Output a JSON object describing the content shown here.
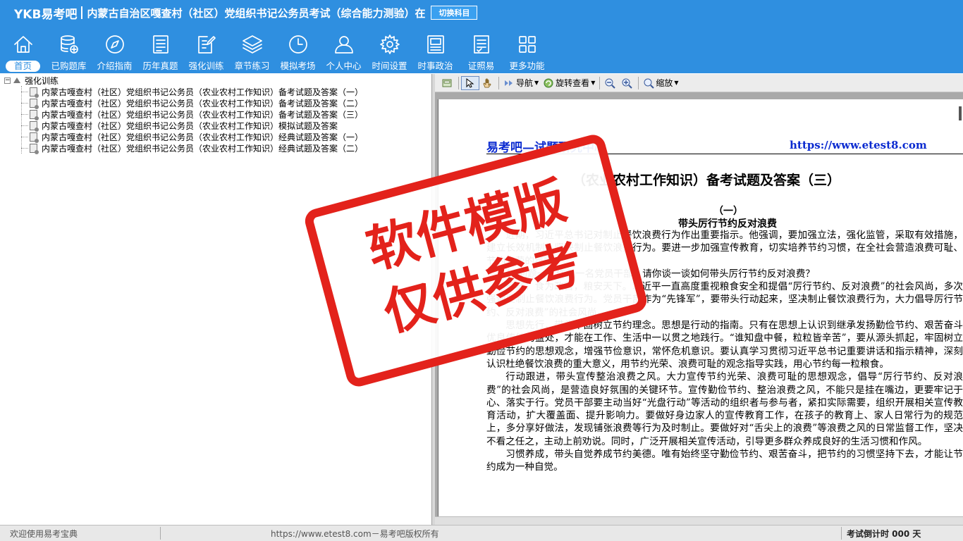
{
  "header": {
    "logo": "YKB易考吧",
    "title": "内蒙古自治区嘎查村（社区）党组织书记公务员考试（综合能力测验）在",
    "switch_label": "切换科目"
  },
  "nav": [
    {
      "label": "首页",
      "icon": "home-icon"
    },
    {
      "label": "已购题库",
      "icon": "database-icon"
    },
    {
      "label": "介绍指南",
      "icon": "compass-icon"
    },
    {
      "label": "历年真题",
      "icon": "list-icon"
    },
    {
      "label": "强化训练",
      "icon": "edit-icon"
    },
    {
      "label": "章节练习",
      "icon": "layers-icon"
    },
    {
      "label": "模拟考场",
      "icon": "clock-icon"
    },
    {
      "label": "个人中心",
      "icon": "user-icon"
    },
    {
      "label": "时间设置",
      "icon": "gear-icon"
    },
    {
      "label": "时事政治",
      "icon": "news-icon"
    },
    {
      "label": "证照易",
      "icon": "certificate-icon"
    },
    {
      "label": "更多功能",
      "icon": "grid-icon"
    }
  ],
  "tree": {
    "root_expander": "−",
    "root": "强化训练",
    "items": [
      "内蒙古嘎查村（社区）党组织书记公务员（农业农村工作知识）备考试题及答案（一）",
      "内蒙古嘎查村（社区）党组织书记公务员（农业农村工作知识）备考试题及答案（二）",
      "内蒙古嘎查村（社区）党组织书记公务员（农业农村工作知识）备考试题及答案（三）",
      "内蒙古嘎查村（社区）党组织书记公务员（农业农村工作知识）模拟试题及答案",
      "内蒙古嘎查村（社区）党组织书记公务员（农业农村工作知识）经典试题及答案（一）",
      "内蒙古嘎查村（社区）党组织书记公务员（农业农村工作知识）经典试题及答案（二）"
    ]
  },
  "toolbar": {
    "nav_label": "导航",
    "rotate_label": "旋转查看",
    "zoom_label": "缩放"
  },
  "document": {
    "brand": "易考吧—试题研究中心",
    "url": "https://www.etest8.com",
    "title": "（农业农村工作知识）备考试题及答案（三）",
    "section": "（一）",
    "subtitle": "带头厉行节约反对浪费",
    "paragraphs": [
      "近期，习近平总书记对制止餐饮浪费行为作出重要指示。他强调，要加强立法，强化监管，采取有效措施，建立长效机制，坚决制止餐饮浪费行为。要进一步加强宣传教育，切实培养节约习惯，在全社会营造浪费可耻、节约为荣的氛围。",
      "1. 问题一：作为一名党员干部，请你谈一谈如何带头厉行节约反对浪费？",
      "答案：食为政首，粮安天下。习近平一直高度重视粮食安全和提倡“厉行节约、反对浪费”的社会风尚，多次强调要制止餐饮浪费行为。党员干部作为“先锋军”，要带头行动起来，坚决制止餐饮浪费行为，大力倡导厉行节约、反对浪费”的社会风尚。",
      "思想先行，带头牢固树立节约理念。思想是行动的指南。只有在思想上认识到继承发扬勤俭节约、艰苦奋斗优良传统的益处，才能在工作、生活中一以贯之地践行。“谁知盘中餐，粒粒皆辛苦”，要从源头抓起，牢固树立勤俭节约的思想观念，增强节俭意识，常怀危机意识。要认真学习贯彻习近平总书记重要讲话和指示精神，深刻认识杜绝餐饮浪费的重大意义，用节约光荣、浪费可耻的观念指导实践，用心节约每一粒粮食。",
      "行动跟进，带头宣传整治浪费之风。大力宣传节约光荣、浪费可耻的思想观念，倡导“厉行节约、反对浪费”的社会风尚，是营造良好氛围的关键环节。宣传勤俭节约、整治浪费之风，不能只是挂在嘴边，更要牢记于心、落实于行。党员干部要主动当好“光盘行动”等活动的组织者与参与者，紧扣实际需要，组织开展相关宣传教育活动，扩大覆盖面、提升影响力。要做好身边家人的宣传教育工作，在孩子的教育上、家人日常行为的规范上，多分享好做法，发现铺张浪费等行为及时制止。要做好对“舌尖上的浪费”等浪费之风的日常监督工作，坚决不看之任之，主动上前劝说。同时，广泛开展相关宣传活动，引导更多群众养成良好的生活习惯和作风。",
      "习惯养成，带头自觉养成节约美德。唯有始终坚守勤俭节约、艰苦奋斗，把节约的习惯坚持下去，才能让节约成为一种自觉。"
    ]
  },
  "stamp": {
    "line1": "软件模版",
    "line2": "仅供参考"
  },
  "status": {
    "left": "欢迎使用易考宝典",
    "middle": "https://www.etest8.com－易考吧版权所有",
    "right": "考试倒计时 000 天"
  },
  "colors": {
    "header_bg": "#2f8fe0",
    "doc_link": "#0b2bd0",
    "stamp": "#e3221b"
  }
}
